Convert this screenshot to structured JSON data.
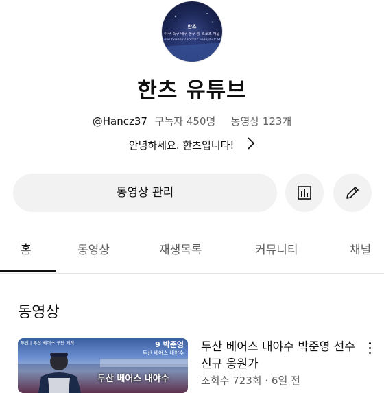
{
  "channel": {
    "avatar": {
      "name": "한츠",
      "subtitle": "야구 축구 배구 농구 등 스포츠 채널",
      "script_text": "Love baseball soccer volleyball Story"
    },
    "title": "한츠 유튜브",
    "handle": "@Hancz37",
    "subscribers": "구독자 450명",
    "videos_count": "동영상 123개",
    "separator": "‧",
    "about": "안녕하세요. 한츠입니다!"
  },
  "actions": {
    "manage_videos_label": "동영상 관리",
    "analytics_icon": "analytics-icon",
    "edit_icon": "pencil-icon"
  },
  "tabs": [
    {
      "label": "홈",
      "active": true
    },
    {
      "label": "동영상",
      "active": false
    },
    {
      "label": "재생목록",
      "active": false
    },
    {
      "label": "커뮤니티",
      "active": false
    },
    {
      "label": "채널",
      "active": false
    }
  ],
  "section": {
    "title": "동영상"
  },
  "video": {
    "thumbnail": {
      "caption": "두산 | 두산 베어스 구단 제작",
      "number": "9 박준영",
      "subtitle": "두산 베어스 내야수",
      "banner": "두산 베어스 내야수"
    },
    "title": "두산 베어스 내야수 박준영 선수 신규 응원가",
    "meta": "조회수 723회 · 6일 전"
  },
  "colors": {
    "text_primary": "#0f0f0f",
    "text_secondary": "#606060",
    "button_bg": "#f2f2f2",
    "divider": "#e5e5e5"
  }
}
